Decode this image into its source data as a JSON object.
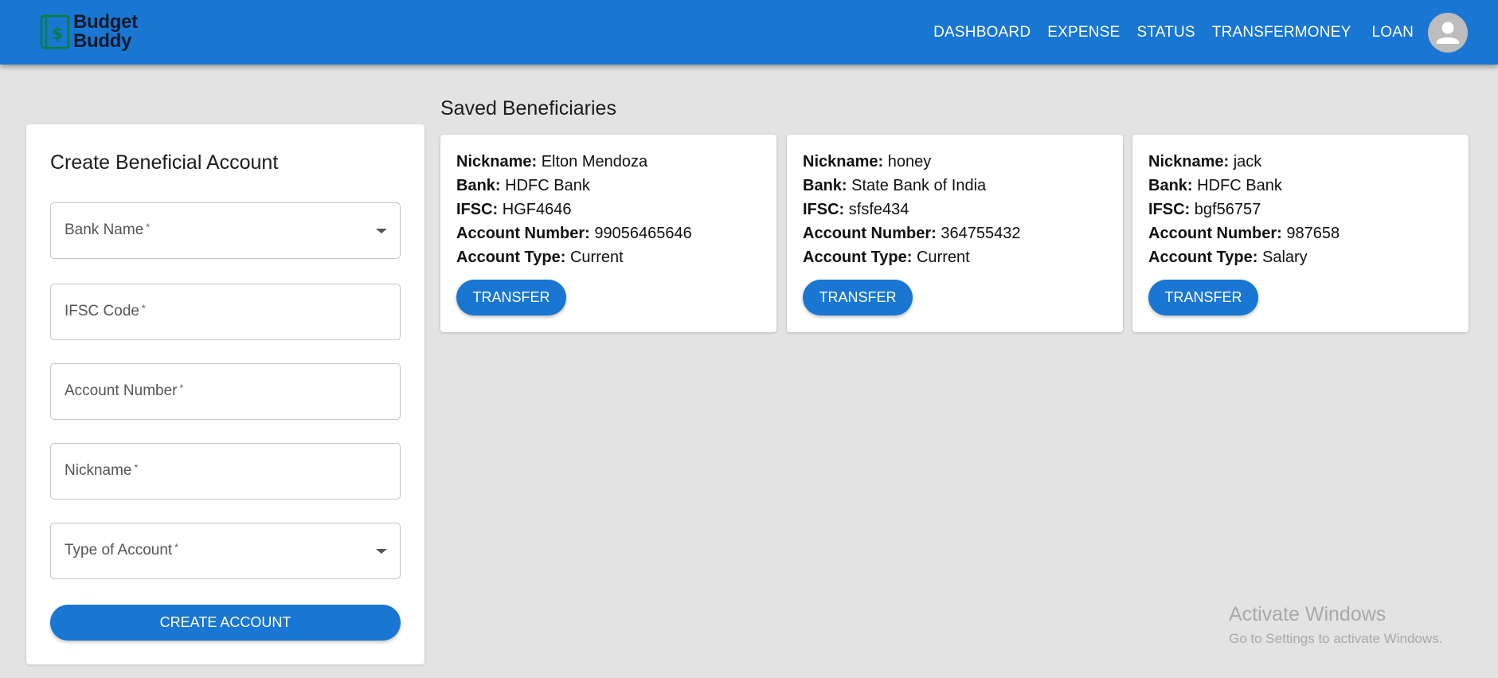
{
  "app": {
    "logo_line1": "Budget",
    "logo_line2": "Buddy",
    "brand_color": "#1976d2",
    "background_color": "#e3e3e3"
  },
  "nav": {
    "items": [
      {
        "label": "DASHBOARD"
      },
      {
        "label": "EXPENSE"
      },
      {
        "label": "STATUS"
      },
      {
        "label": "TRANSFERMONEY"
      },
      {
        "label": "LOAN"
      }
    ],
    "avatar_icon": "account-circle-icon"
  },
  "form": {
    "title": "Create Beneficial Account",
    "fields": [
      {
        "label": "Bank Name",
        "required_mark": "*",
        "type": "select"
      },
      {
        "label": "IFSC Code",
        "required_mark": "*",
        "type": "text"
      },
      {
        "label": "Account Number",
        "required_mark": "*",
        "type": "text"
      },
      {
        "label": "Nickname",
        "required_mark": "*",
        "type": "text"
      },
      {
        "label": "Type of Account",
        "required_mark": "*",
        "type": "select"
      }
    ],
    "submit_label": "CREATE ACCOUNT"
  },
  "beneficiaries": {
    "title": "Saved Beneficiaries",
    "field_labels": {
      "nickname": "Nickname:",
      "bank": "Bank:",
      "ifsc": "IFSC:",
      "account_number": "Account Number:",
      "account_type": "Account Type:"
    },
    "items": [
      {
        "nickname": "Elton Mendoza",
        "bank": "HDFC Bank",
        "ifsc": "HGF4646",
        "account_number": "99056465646",
        "account_type": "Current",
        "action_label": "TRANSFER"
      },
      {
        "nickname": "honey",
        "bank": "State Bank of India",
        "ifsc": "sfsfe434",
        "account_number": "364755432",
        "account_type": "Current",
        "action_label": "TRANSFER"
      },
      {
        "nickname": "jack",
        "bank": "HDFC Bank",
        "ifsc": "bgf56757",
        "account_number": "987658",
        "account_type": "Salary",
        "action_label": "TRANSFER"
      }
    ]
  },
  "watermark": {
    "line1": "Activate Windows",
    "line2": "Go to Settings to activate Windows."
  }
}
